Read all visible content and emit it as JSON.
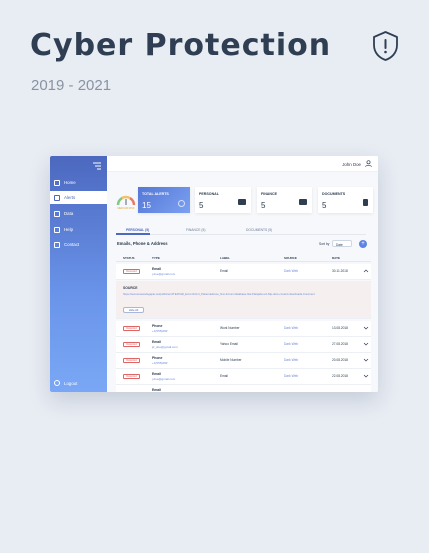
{
  "hero": {
    "title": "Cyber Protection",
    "years": "2019 - 2021"
  },
  "colors": {
    "accent": "#4c68bf",
    "alert": "#e06565",
    "link": "#6e8ad8"
  },
  "sidebar": {
    "items": [
      {
        "label": "Home",
        "icon": "home-icon"
      },
      {
        "label": "Alerts",
        "icon": "alert-icon"
      },
      {
        "label": "Data",
        "icon": "data-icon"
      },
      {
        "label": "Help",
        "icon": "help-icon"
      },
      {
        "label": "Contact",
        "icon": "contact-icon"
      }
    ],
    "logout": "Logout"
  },
  "topbar": {
    "user": "John Doe"
  },
  "gauge_label": "MEDIUM RISK",
  "cards": [
    {
      "title": "TOTAL ALERTS",
      "value": "15"
    },
    {
      "title": "PERSONAL",
      "value": "5"
    },
    {
      "title": "FINANCE",
      "value": "5"
    },
    {
      "title": "DOCUMENTS",
      "value": "5"
    }
  ],
  "tabs": [
    "PERSONAL (5)",
    "FINANCE (5)",
    "DOCUMENTS (5)"
  ],
  "section": {
    "title": "Emails, Phone & Address",
    "sort_label": "Sort by",
    "sort_value": "Date",
    "add": "+"
  },
  "table": {
    "headers": [
      "STATUS",
      "TYPE",
      "LABEL",
      "SOURCE",
      "DATE"
    ],
    "rows": [
      {
        "status": "Detected",
        "type": "Email",
        "sub": "j.doe@gmail.com",
        "label": "Email",
        "source": "Dark Web",
        "date": "30.11.2018"
      },
      {
        "status": "Detected",
        "type": "Phone",
        "sub": "+1(555)###",
        "label": "Work Number",
        "source": "Dark Web",
        "date": "13.08.2018"
      },
      {
        "status": "Detected",
        "type": "Email",
        "sub": "jd_doe@gmail.com",
        "label": "Yahoo Email",
        "source": "Dark Web",
        "date": "27.08.2018"
      },
      {
        "status": "Detected",
        "type": "Phone",
        "sub": "+1(555)###",
        "label": "Mobile Number",
        "source": "Dark Web",
        "date": "20.08.2018"
      },
      {
        "status": "Detected",
        "type": "Email",
        "sub": "j.doe@gmail.com",
        "label": "Email",
        "source": "Dark Web",
        "date": "22.08.2018"
      }
    ],
    "partial_row": {
      "type": "Email"
    },
    "expanded": {
      "title": "SOURCE",
      "text": "https://securenewsdogaple.net/public/en/JTE4%3D_Ecnt-Onlmrt_Patternadonne_Nvo-Forum-Database-hist-Pattqabs-ucl-Ntp-docs-content-downloads-Comment",
      "button": "Hide All"
    }
  }
}
